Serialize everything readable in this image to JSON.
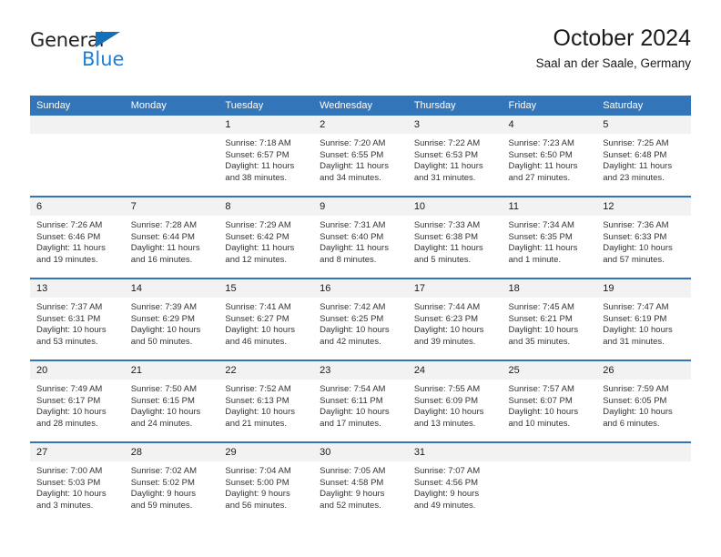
{
  "logo": {
    "word_one": "General",
    "word_two": "Blue",
    "triangle_icon": "triangle-flag-icon",
    "accent_color": "#1470b8",
    "blue_text_color": "#1b7fd4"
  },
  "header": {
    "title": "October 2024",
    "subtitle": "Saal an der Saale, Germany"
  },
  "theme": {
    "header_blue": "#3275b8",
    "daynum_band": "#f2f2f2",
    "text_color": "#333333"
  },
  "weekday_headers": [
    "Sunday",
    "Monday",
    "Tuesday",
    "Wednesday",
    "Thursday",
    "Friday",
    "Saturday"
  ],
  "labels": {
    "sunrise_prefix": "Sunrise:",
    "sunset_prefix": "Sunset:",
    "daylight_prefix": "Daylight:"
  },
  "weeks": [
    [
      {
        "day": "",
        "empty": true,
        "sunrise": "",
        "sunset": "",
        "daylight_line1": "",
        "daylight_line2": ""
      },
      {
        "day": "",
        "empty": true,
        "sunrise": "",
        "sunset": "",
        "daylight_line1": "",
        "daylight_line2": ""
      },
      {
        "day": "1",
        "empty": false,
        "sunrise": "Sunrise: 7:18 AM",
        "sunset": "Sunset: 6:57 PM",
        "daylight_line1": "Daylight: 11 hours",
        "daylight_line2": "and 38 minutes."
      },
      {
        "day": "2",
        "empty": false,
        "sunrise": "Sunrise: 7:20 AM",
        "sunset": "Sunset: 6:55 PM",
        "daylight_line1": "Daylight: 11 hours",
        "daylight_line2": "and 34 minutes."
      },
      {
        "day": "3",
        "empty": false,
        "sunrise": "Sunrise: 7:22 AM",
        "sunset": "Sunset: 6:53 PM",
        "daylight_line1": "Daylight: 11 hours",
        "daylight_line2": "and 31 minutes."
      },
      {
        "day": "4",
        "empty": false,
        "sunrise": "Sunrise: 7:23 AM",
        "sunset": "Sunset: 6:50 PM",
        "daylight_line1": "Daylight: 11 hours",
        "daylight_line2": "and 27 minutes."
      },
      {
        "day": "5",
        "empty": false,
        "sunrise": "Sunrise: 7:25 AM",
        "sunset": "Sunset: 6:48 PM",
        "daylight_line1": "Daylight: 11 hours",
        "daylight_line2": "and 23 minutes."
      }
    ],
    [
      {
        "day": "6",
        "empty": false,
        "sunrise": "Sunrise: 7:26 AM",
        "sunset": "Sunset: 6:46 PM",
        "daylight_line1": "Daylight: 11 hours",
        "daylight_line2": "and 19 minutes."
      },
      {
        "day": "7",
        "empty": false,
        "sunrise": "Sunrise: 7:28 AM",
        "sunset": "Sunset: 6:44 PM",
        "daylight_line1": "Daylight: 11 hours",
        "daylight_line2": "and 16 minutes."
      },
      {
        "day": "8",
        "empty": false,
        "sunrise": "Sunrise: 7:29 AM",
        "sunset": "Sunset: 6:42 PM",
        "daylight_line1": "Daylight: 11 hours",
        "daylight_line2": "and 12 minutes."
      },
      {
        "day": "9",
        "empty": false,
        "sunrise": "Sunrise: 7:31 AM",
        "sunset": "Sunset: 6:40 PM",
        "daylight_line1": "Daylight: 11 hours",
        "daylight_line2": "and 8 minutes."
      },
      {
        "day": "10",
        "empty": false,
        "sunrise": "Sunrise: 7:33 AM",
        "sunset": "Sunset: 6:38 PM",
        "daylight_line1": "Daylight: 11 hours",
        "daylight_line2": "and 5 minutes."
      },
      {
        "day": "11",
        "empty": false,
        "sunrise": "Sunrise: 7:34 AM",
        "sunset": "Sunset: 6:35 PM",
        "daylight_line1": "Daylight: 11 hours",
        "daylight_line2": "and 1 minute."
      },
      {
        "day": "12",
        "empty": false,
        "sunrise": "Sunrise: 7:36 AM",
        "sunset": "Sunset: 6:33 PM",
        "daylight_line1": "Daylight: 10 hours",
        "daylight_line2": "and 57 minutes."
      }
    ],
    [
      {
        "day": "13",
        "empty": false,
        "sunrise": "Sunrise: 7:37 AM",
        "sunset": "Sunset: 6:31 PM",
        "daylight_line1": "Daylight: 10 hours",
        "daylight_line2": "and 53 minutes."
      },
      {
        "day": "14",
        "empty": false,
        "sunrise": "Sunrise: 7:39 AM",
        "sunset": "Sunset: 6:29 PM",
        "daylight_line1": "Daylight: 10 hours",
        "daylight_line2": "and 50 minutes."
      },
      {
        "day": "15",
        "empty": false,
        "sunrise": "Sunrise: 7:41 AM",
        "sunset": "Sunset: 6:27 PM",
        "daylight_line1": "Daylight: 10 hours",
        "daylight_line2": "and 46 minutes."
      },
      {
        "day": "16",
        "empty": false,
        "sunrise": "Sunrise: 7:42 AM",
        "sunset": "Sunset: 6:25 PM",
        "daylight_line1": "Daylight: 10 hours",
        "daylight_line2": "and 42 minutes."
      },
      {
        "day": "17",
        "empty": false,
        "sunrise": "Sunrise: 7:44 AM",
        "sunset": "Sunset: 6:23 PM",
        "daylight_line1": "Daylight: 10 hours",
        "daylight_line2": "and 39 minutes."
      },
      {
        "day": "18",
        "empty": false,
        "sunrise": "Sunrise: 7:45 AM",
        "sunset": "Sunset: 6:21 PM",
        "daylight_line1": "Daylight: 10 hours",
        "daylight_line2": "and 35 minutes."
      },
      {
        "day": "19",
        "empty": false,
        "sunrise": "Sunrise: 7:47 AM",
        "sunset": "Sunset: 6:19 PM",
        "daylight_line1": "Daylight: 10 hours",
        "daylight_line2": "and 31 minutes."
      }
    ],
    [
      {
        "day": "20",
        "empty": false,
        "sunrise": "Sunrise: 7:49 AM",
        "sunset": "Sunset: 6:17 PM",
        "daylight_line1": "Daylight: 10 hours",
        "daylight_line2": "and 28 minutes."
      },
      {
        "day": "21",
        "empty": false,
        "sunrise": "Sunrise: 7:50 AM",
        "sunset": "Sunset: 6:15 PM",
        "daylight_line1": "Daylight: 10 hours",
        "daylight_line2": "and 24 minutes."
      },
      {
        "day": "22",
        "empty": false,
        "sunrise": "Sunrise: 7:52 AM",
        "sunset": "Sunset: 6:13 PM",
        "daylight_line1": "Daylight: 10 hours",
        "daylight_line2": "and 21 minutes."
      },
      {
        "day": "23",
        "empty": false,
        "sunrise": "Sunrise: 7:54 AM",
        "sunset": "Sunset: 6:11 PM",
        "daylight_line1": "Daylight: 10 hours",
        "daylight_line2": "and 17 minutes."
      },
      {
        "day": "24",
        "empty": false,
        "sunrise": "Sunrise: 7:55 AM",
        "sunset": "Sunset: 6:09 PM",
        "daylight_line1": "Daylight: 10 hours",
        "daylight_line2": "and 13 minutes."
      },
      {
        "day": "25",
        "empty": false,
        "sunrise": "Sunrise: 7:57 AM",
        "sunset": "Sunset: 6:07 PM",
        "daylight_line1": "Daylight: 10 hours",
        "daylight_line2": "and 10 minutes."
      },
      {
        "day": "26",
        "empty": false,
        "sunrise": "Sunrise: 7:59 AM",
        "sunset": "Sunset: 6:05 PM",
        "daylight_line1": "Daylight: 10 hours",
        "daylight_line2": "and 6 minutes."
      }
    ],
    [
      {
        "day": "27",
        "empty": false,
        "sunrise": "Sunrise: 7:00 AM",
        "sunset": "Sunset: 5:03 PM",
        "daylight_line1": "Daylight: 10 hours",
        "daylight_line2": "and 3 minutes."
      },
      {
        "day": "28",
        "empty": false,
        "sunrise": "Sunrise: 7:02 AM",
        "sunset": "Sunset: 5:02 PM",
        "daylight_line1": "Daylight: 9 hours",
        "daylight_line2": "and 59 minutes."
      },
      {
        "day": "29",
        "empty": false,
        "sunrise": "Sunrise: 7:04 AM",
        "sunset": "Sunset: 5:00 PM",
        "daylight_line1": "Daylight: 9 hours",
        "daylight_line2": "and 56 minutes."
      },
      {
        "day": "30",
        "empty": false,
        "sunrise": "Sunrise: 7:05 AM",
        "sunset": "Sunset: 4:58 PM",
        "daylight_line1": "Daylight: 9 hours",
        "daylight_line2": "and 52 minutes."
      },
      {
        "day": "31",
        "empty": false,
        "sunrise": "Sunrise: 7:07 AM",
        "sunset": "Sunset: 4:56 PM",
        "daylight_line1": "Daylight: 9 hours",
        "daylight_line2": "and 49 minutes."
      },
      {
        "day": "",
        "empty": true,
        "sunrise": "",
        "sunset": "",
        "daylight_line1": "",
        "daylight_line2": ""
      },
      {
        "day": "",
        "empty": true,
        "sunrise": "",
        "sunset": "",
        "daylight_line1": "",
        "daylight_line2": ""
      }
    ]
  ]
}
